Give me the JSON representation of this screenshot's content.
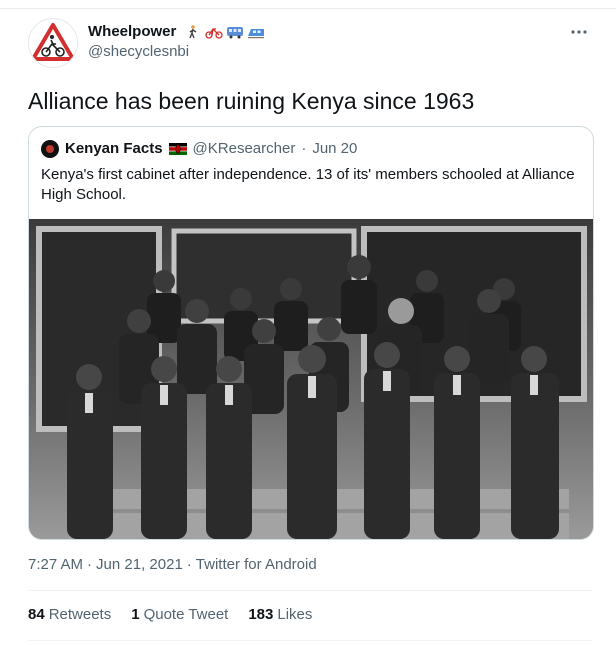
{
  "author": {
    "display_name": "Wheelpower",
    "handle": "@shecyclesnbi",
    "emojis": [
      "person-walking-icon",
      "bicycle-icon",
      "bus-icon",
      "train-icon"
    ]
  },
  "tweet": {
    "text": "Alliance has been ruining Kenya since 1963"
  },
  "quote": {
    "display_name": "Kenyan Facts",
    "handle": "@KResearcher",
    "separator": "·",
    "date": "Jun 20",
    "text": "Kenya's first cabinet after independence. 13 of its' members schooled at Alliance High School.",
    "image_alt": "black-and-white group photo of cabinet members"
  },
  "meta": {
    "time": "7:27 AM",
    "sep1": "·",
    "date": "Jun 21, 2021",
    "sep2": "·",
    "source": "Twitter for Android"
  },
  "stats": {
    "retweets_count": "84",
    "retweets_label": "Retweets",
    "quotes_count": "1",
    "quotes_label": "Quote Tweet",
    "likes_count": "183",
    "likes_label": "Likes"
  },
  "more_icon": "more-options-icon"
}
